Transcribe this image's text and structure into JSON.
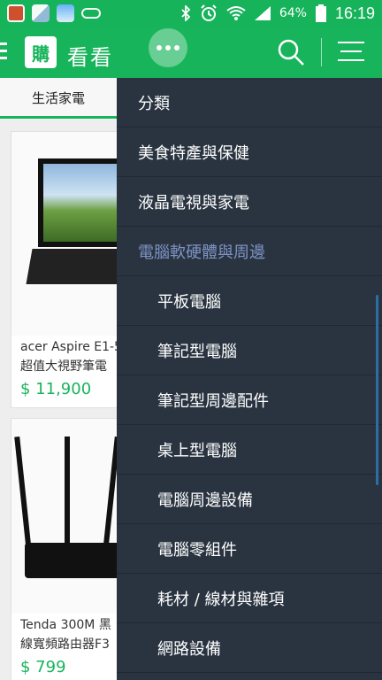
{
  "status_bar": {
    "battery": "64%",
    "time": "16:19",
    "icons": [
      "app-notification-icon",
      "gallery-icon",
      "weather-icon",
      "pill-icon",
      "bluetooth-icon",
      "alarm-icon",
      "wifi-icon",
      "signal-icon",
      "battery-icon"
    ]
  },
  "app_bar": {
    "logo_text": "購",
    "title": "看看",
    "more_icon": "more-dots-icon",
    "search_icon": "search-icon",
    "menu_icon": "menu-icon"
  },
  "background": {
    "category_tab": "生活家電",
    "cards": [
      {
        "name": "acer Aspire E1-5",
        "name2": "超值大視野筆電",
        "price": "$ 11,900"
      },
      {
        "name": "Tenda  300M 黑",
        "name2": "線寬頻路由器F3",
        "price": "$ 799"
      }
    ]
  },
  "drawer": {
    "header": "分類",
    "items": [
      {
        "label": "美食特產與保健",
        "sub": false,
        "active": false
      },
      {
        "label": "液晶電視與家電",
        "sub": false,
        "active": false
      },
      {
        "label": "電腦軟硬體與周邊",
        "sub": false,
        "active": true
      },
      {
        "label": "平板電腦",
        "sub": true,
        "active": false
      },
      {
        "label": "筆記型電腦",
        "sub": true,
        "active": false
      },
      {
        "label": "筆記型周邊配件",
        "sub": true,
        "active": false
      },
      {
        "label": "桌上型電腦",
        "sub": true,
        "active": false
      },
      {
        "label": "電腦周邊設備",
        "sub": true,
        "active": false
      },
      {
        "label": "電腦零組件",
        "sub": true,
        "active": false
      },
      {
        "label": "耗材 / 線材與雜項",
        "sub": true,
        "active": false
      },
      {
        "label": "網路設備",
        "sub": true,
        "active": false
      }
    ]
  },
  "colors": {
    "brand_green": "#18b45b",
    "drawer_bg": "#2a3441",
    "active_item": "#7e93c4",
    "price": "#18b45b"
  }
}
